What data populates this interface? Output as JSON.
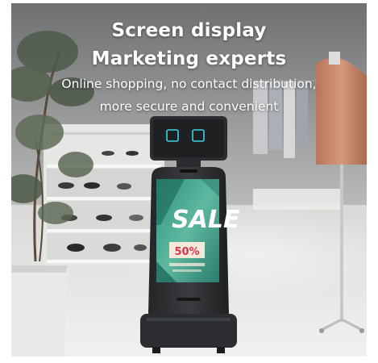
{
  "headline": {
    "line1": "Screen display",
    "line2": "Marketing experts"
  },
  "subheadline": {
    "line1": "Online shopping, no contact distribution,",
    "line2": "more secure and convenient"
  },
  "robot_screen": {
    "sale_text": "SALE",
    "discount": "50%"
  },
  "colors": {
    "robot_body": "#2e3033",
    "eye_accent": "#3ad6e6",
    "screen_teal": "#2c9a86",
    "discount_red": "#d8334a"
  }
}
